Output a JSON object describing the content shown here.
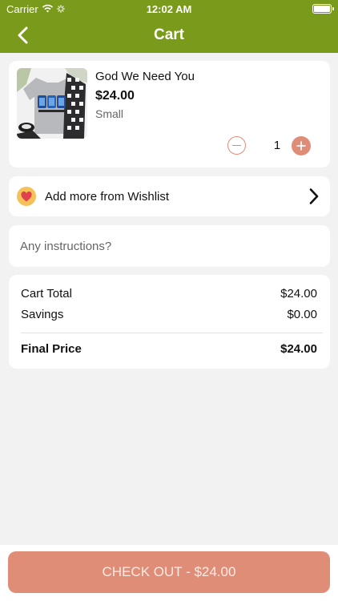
{
  "status_bar": {
    "carrier": "Carrier",
    "time": "12:02 AM"
  },
  "header": {
    "title": "Cart"
  },
  "cart_item": {
    "title": "God We Need You",
    "price": "$24.00",
    "size": "Small",
    "quantity": "1"
  },
  "wishlist": {
    "label": "Add more from Wishlist"
  },
  "instructions": {
    "placeholder": "Any instructions?"
  },
  "summary": {
    "cart_total_label": "Cart Total",
    "cart_total_value": "$24.00",
    "savings_label": "Savings",
    "savings_value": "$0.00",
    "final_price_label": "Final Price",
    "final_price_value": "$24.00"
  },
  "checkout": {
    "label": "CHECK OUT - $24.00"
  },
  "colors": {
    "header": "#7a9a1c",
    "accent": "#e08d78",
    "background": "#f2f2f2"
  }
}
